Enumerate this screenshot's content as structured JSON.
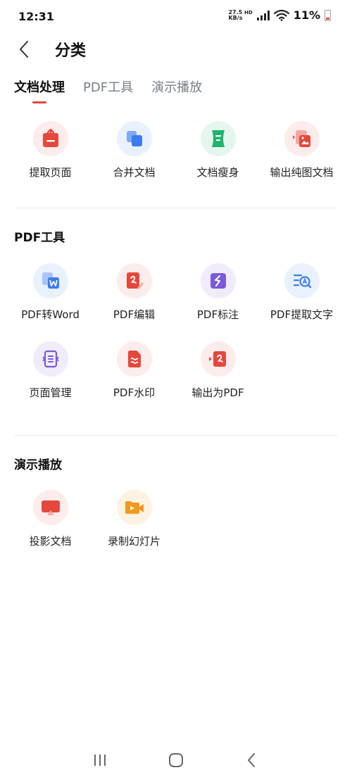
{
  "status": {
    "time": "12:31",
    "net_speed_value": "27.5",
    "net_speed_unit": "KB/s",
    "net_type": "HD",
    "battery": "11%"
  },
  "header": {
    "title": "分类"
  },
  "tabs": [
    {
      "label": "文档处理",
      "active": true
    },
    {
      "label": "PDF工具",
      "active": false
    },
    {
      "label": "演示播放",
      "active": false
    }
  ],
  "doc_tools": [
    {
      "label": "提取页面",
      "icon": "extract-page-icon"
    },
    {
      "label": "合并文档",
      "icon": "merge-docs-icon"
    },
    {
      "label": "文档瘦身",
      "icon": "slim-doc-icon"
    },
    {
      "label": "输出纯图文档",
      "icon": "export-image-doc-icon"
    }
  ],
  "pdf_section": {
    "title": "PDF工具",
    "tools": [
      {
        "label": "PDF转Word",
        "icon": "pdf-to-word-icon"
      },
      {
        "label": "PDF编辑",
        "icon": "pdf-edit-icon"
      },
      {
        "label": "PDF标注",
        "icon": "pdf-annotate-icon"
      },
      {
        "label": "PDF提取文字",
        "icon": "pdf-extract-text-icon"
      },
      {
        "label": "页面管理",
        "icon": "page-manage-icon"
      },
      {
        "label": "PDF水印",
        "icon": "pdf-watermark-icon"
      },
      {
        "label": "输出为PDF",
        "icon": "export-pdf-icon"
      }
    ]
  },
  "present_section": {
    "title": "演示播放",
    "tools": [
      {
        "label": "投影文档",
        "icon": "project-doc-icon"
      },
      {
        "label": "录制幻灯片",
        "icon": "record-slides-icon"
      }
    ]
  },
  "colors": {
    "accent": "#e4483c",
    "blue": "#3b7cf0",
    "green": "#1fb36b",
    "purple": "#7b5ad9",
    "orange": "#f39a1e"
  }
}
